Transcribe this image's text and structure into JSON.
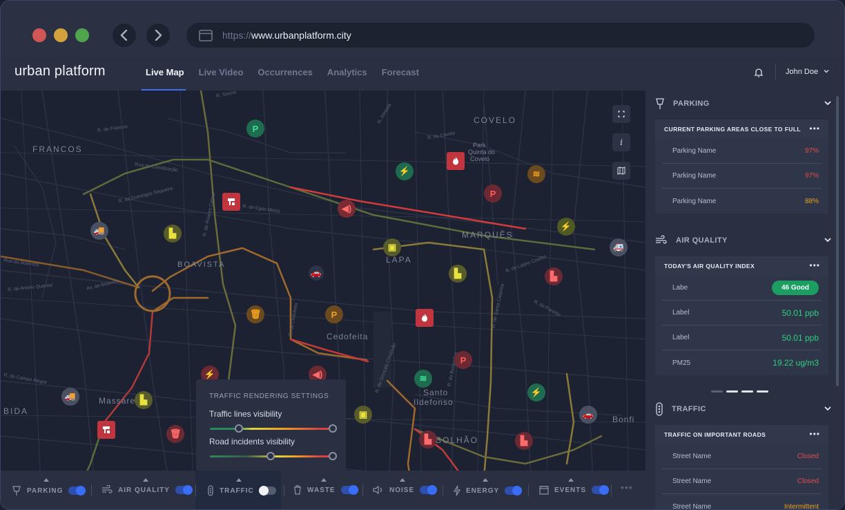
{
  "browser": {
    "url_scheme": "https://",
    "url_host": "www.urbanplatform.city"
  },
  "app": {
    "brand": "urban platform",
    "tabs": [
      {
        "label": "Live Map",
        "active": true
      },
      {
        "label": "Live Video",
        "active": false
      },
      {
        "label": "Occurrences",
        "active": false
      },
      {
        "label": "Analytics",
        "active": false
      },
      {
        "label": "Forecast",
        "active": false
      }
    ],
    "user": "John Doe"
  },
  "map": {
    "areas": [
      "FRANCOS",
      "COVELO",
      "MARQUÊS",
      "BOAVISTA",
      "LAPA",
      "Cedofeita",
      "Massarelos",
      "Santo",
      "Ildefonso",
      "BOLHÃO",
      "BIDA",
      "Bonfi",
      "Park",
      "Quinta do",
      "Covelo"
    ],
    "streets": [
      "R. de Francos",
      "R. Sousa",
      "R. Almada",
      "R. do Covelo",
      "Rua da Constituição",
      "R. de Domingos Sequeira",
      "R. de Egas Moniz",
      "Rua da Boavista",
      "Av. da Boavista",
      "R. do Campo Alegre",
      "R. de Antero Quental",
      "R. do Paraíso",
      "R. de Gonçalo Cristóvão",
      "R. de Santa Catarina",
      "R. de Latino Coelho",
      "R. do Bonjardim",
      "R. de Álvares Cabral",
      "R. de Cedofeita"
    ],
    "settings": {
      "title": "TRAFFIC RENDERING SETTINGS",
      "lines_label": "Traffic lines visibility",
      "incidents_label": "Road incidents visibility"
    },
    "controls": {
      "info_label": "i"
    }
  },
  "layers": [
    {
      "label": "PARKING",
      "on": true,
      "icon": "parking-sign-icon"
    },
    {
      "label": "AIR QUALITY",
      "on": true,
      "icon": "wind-icon"
    },
    {
      "label": "TRAFFIC",
      "on": false,
      "icon": "traffic-light-icon"
    },
    {
      "label": "WASTE",
      "on": true,
      "icon": "trash-icon"
    },
    {
      "label": "NOISE",
      "on": true,
      "icon": "speaker-icon"
    },
    {
      "label": "ENERGY",
      "on": true,
      "icon": "lightning-icon"
    },
    {
      "label": "EVENTS",
      "on": true,
      "icon": "calendar-icon"
    }
  ],
  "panel": {
    "parking": {
      "title": "PARKING",
      "card_title": "CURRENT PARKING AREAS CLOSE TO FULL",
      "rows": [
        {
          "name": "Parking Name",
          "value": "97%",
          "status": "red"
        },
        {
          "name": "Parking Name",
          "value": "97%",
          "status": "red"
        },
        {
          "name": "Parking Name",
          "value": "88%",
          "status": "orange"
        }
      ]
    },
    "air": {
      "title": "AIR QUALITY",
      "card_title": "TODAY'S AIR QUALITY INDEX",
      "index_label": "Labe",
      "index_badge": "46 Good",
      "rows": [
        {
          "name": "Label",
          "value": "50.01 ppb"
        },
        {
          "name": "Label",
          "value": "50.01 ppb"
        },
        {
          "name": "PM25",
          "value": "19.22 ug/m3"
        }
      ]
    },
    "traffic": {
      "title": "TRAFFIC",
      "card_title": "TRAFFIC ON IMPORTANT ROADS",
      "rows": [
        {
          "name": "Street Name",
          "value": "Closed",
          "status": "red"
        },
        {
          "name": "Street Name",
          "value": "Closed",
          "status": "red"
        },
        {
          "name": "Street Name",
          "value": "Intermittent",
          "status": "orange"
        }
      ]
    }
  },
  "colors": {
    "accent": "#3f6ff0",
    "danger": "#e24b4b",
    "warning": "#f0a020",
    "good": "#2fcf80"
  }
}
